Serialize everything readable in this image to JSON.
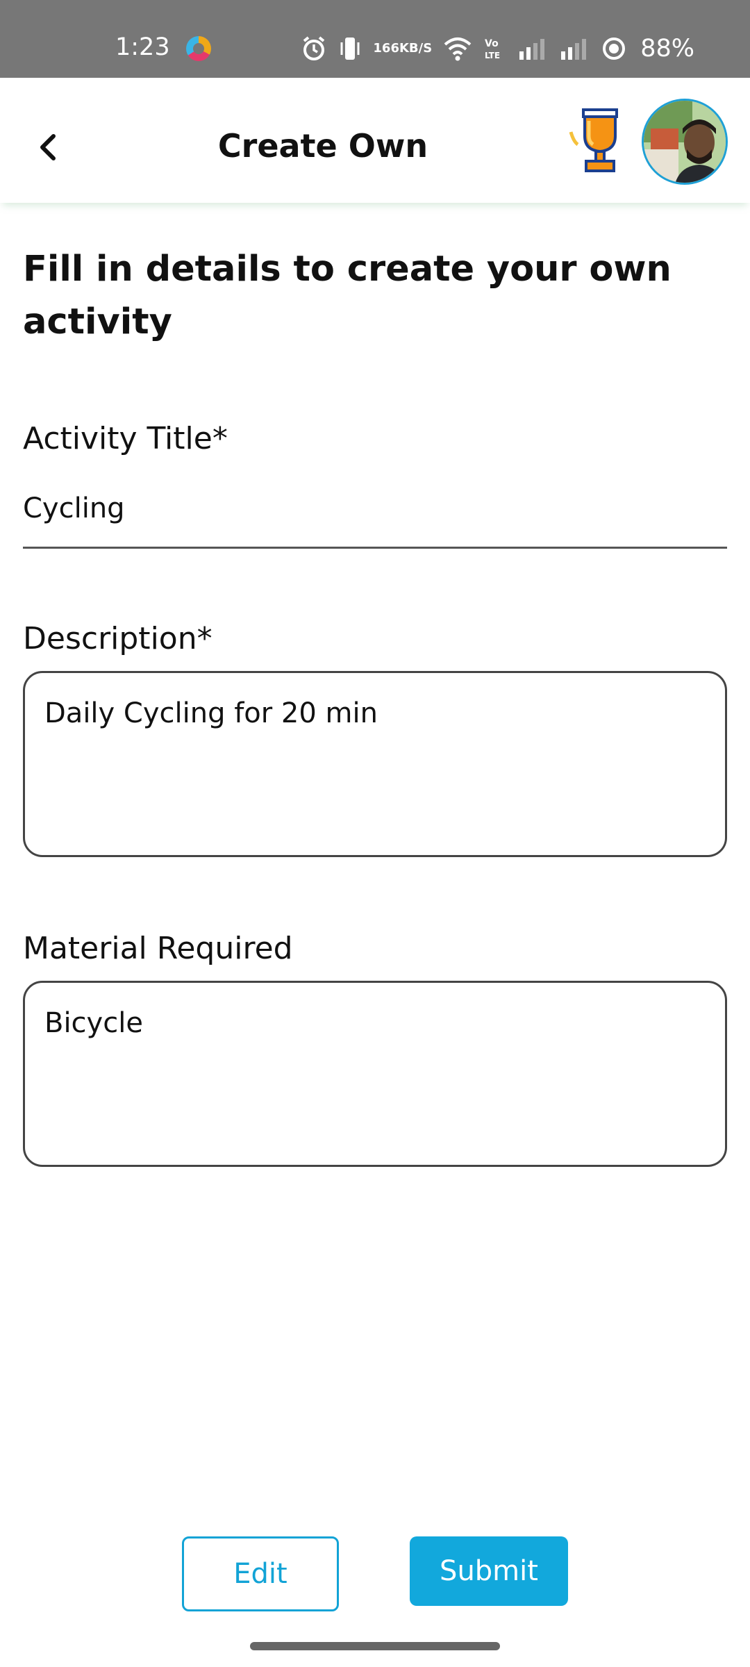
{
  "status_bar": {
    "time": "1:23",
    "speed_top": "166",
    "speed_unit": "KB/S",
    "battery": "88%",
    "icons": [
      "alarm-icon",
      "vibrate-icon",
      "wifi-icon",
      "volte-icon",
      "signal-icon",
      "signal-icon",
      "battery-icon"
    ]
  },
  "appbar": {
    "title": "Create Own",
    "icons": [
      "back-chevron-icon",
      "trophy-icon",
      "avatar"
    ]
  },
  "form": {
    "heading": "Fill in details to create your own activity",
    "activity_title": {
      "label": "Activity Title*",
      "value": "Cycling"
    },
    "description": {
      "label": "Description*",
      "value": "Daily Cycling for 20 min"
    },
    "material": {
      "label": "Material Required",
      "value": "Bicycle"
    }
  },
  "actions": {
    "edit_label": "Edit",
    "submit_label": "Submit"
  },
  "colors": {
    "status_bar": "#777777",
    "accent": "#12a8dc",
    "text": "#111111"
  }
}
